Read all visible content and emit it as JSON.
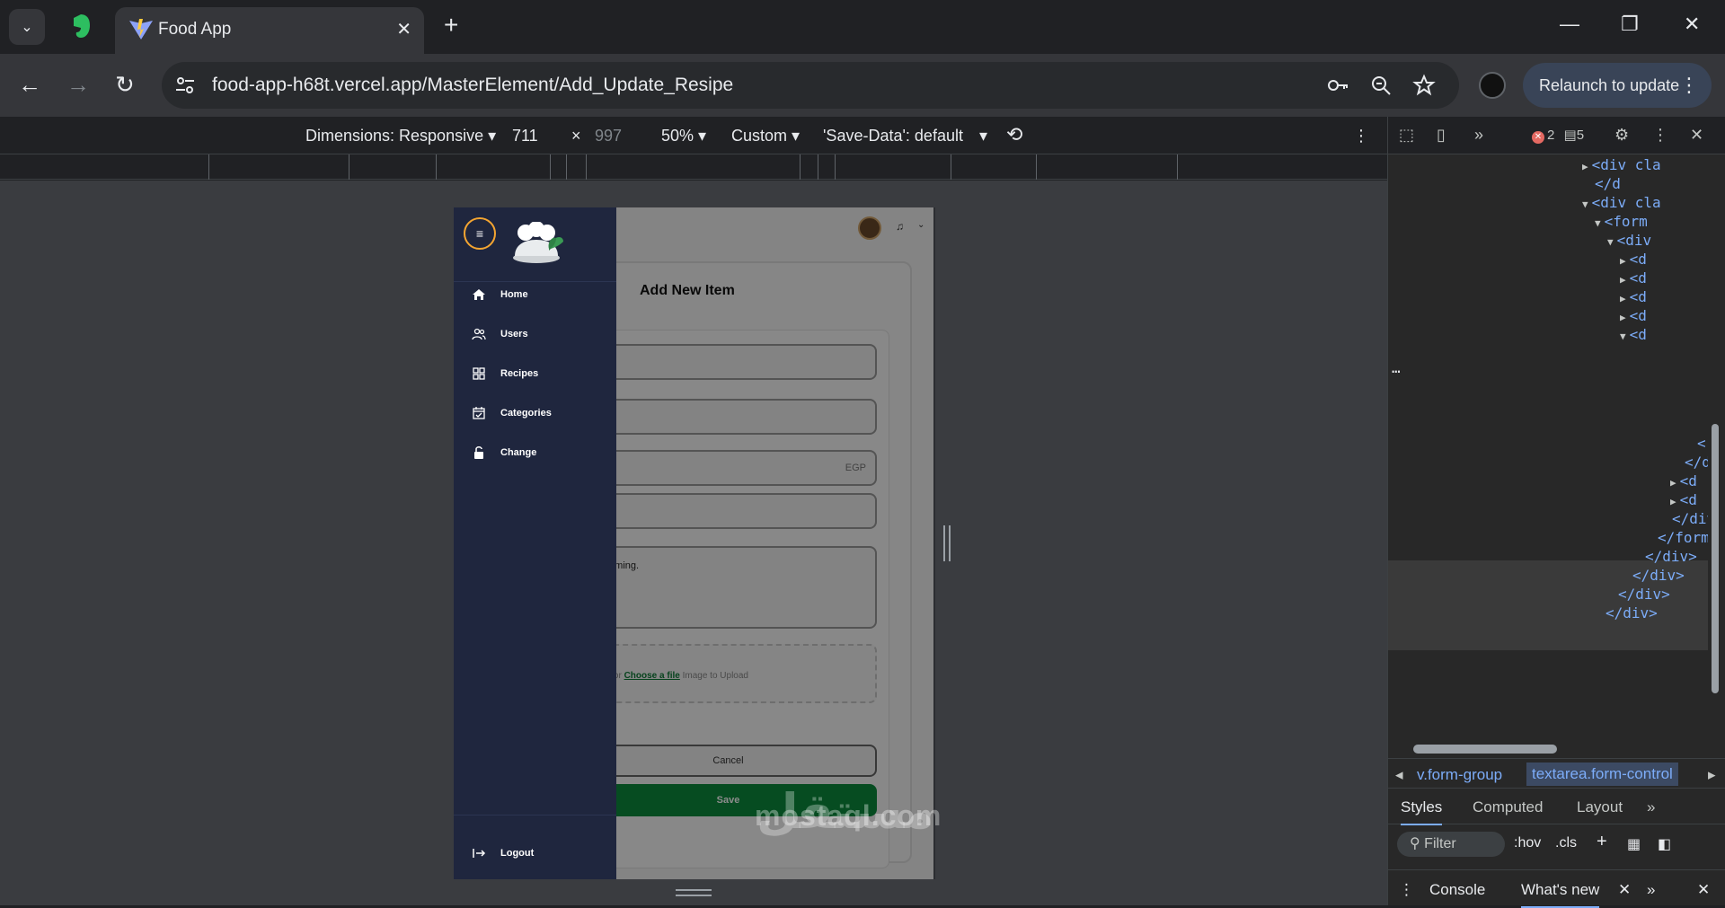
{
  "browser": {
    "tab_title": "Food App",
    "url": "food-app-h68t.vercel.app/MasterElement/Add_Update_Resipe",
    "relaunch_label": "Relaunch to update"
  },
  "device_toolbar": {
    "dimensions_label": "Dimensions: Responsive ▾",
    "width": "711",
    "times": "×",
    "height": "997",
    "zoom": "50% ▾",
    "throttle": "Custom ▾",
    "save_data": "'Save-Data': default"
  },
  "app": {
    "sidebar": {
      "items": [
        {
          "label": "Home"
        },
        {
          "label": "Users"
        },
        {
          "label": "Recipes"
        },
        {
          "label": "Categories"
        },
        {
          "label": "Change"
        }
      ],
      "logout": "Logout"
    },
    "form": {
      "title": "Add New Item",
      "price_suffix": "EGP",
      "description_value": "ogramming.",
      "upload_prefix": "& Drop or ",
      "upload_link": "Choose a file",
      "upload_suffix": " Image to Upload",
      "cancel_label": "Cancel",
      "save_label": "Save"
    }
  },
  "devtools": {
    "errors": "2",
    "messages": "5",
    "code_lines": [
      {
        "text": "<div cla",
        "tri": "▶"
      },
      {
        "text": "</d",
        "tri": ""
      },
      {
        "text": "<div cla",
        "tri": "▼"
      },
      {
        "text": "<form",
        "tri": "▼"
      },
      {
        "text": "<div",
        "tri": "▼"
      },
      {
        "text": "<d",
        "tri": "▶"
      },
      {
        "text": "<d",
        "tri": "▶"
      },
      {
        "text": "<d",
        "tri": "▶"
      },
      {
        "text": "<d",
        "tri": "▶"
      },
      {
        "text": "<d",
        "tri": "▼"
      }
    ],
    "code_lines_bottom": [
      {
        "text": "<",
        "tri": ""
      },
      {
        "text": "</d",
        "tri": ""
      },
      {
        "text": "<d",
        "tri": "▶"
      },
      {
        "text": "<d",
        "tri": "▶"
      },
      {
        "text": "</div",
        "tri": ""
      },
      {
        "text": "</form",
        "tri": ""
      },
      {
        "text": "</div>",
        "tri": ""
      },
      {
        "text": "</div>",
        "tri": ""
      },
      {
        "text": "</div>",
        "tri": ""
      },
      {
        "text": "</div>",
        "tri": ""
      }
    ],
    "ellipsis": "…",
    "breadcrumb_prev": "v.form-group",
    "breadcrumb_active": "textarea.form-control",
    "styles_tabs": [
      "Styles",
      "Computed",
      "Layout"
    ],
    "filter_placeholder": "Filter",
    "hov": ":hov",
    "cls": ".cls",
    "drawer_tabs": [
      "Console",
      "What's new"
    ]
  },
  "watermark": {
    "latin": "mostaql.com",
    "arabic": "مستقل"
  },
  "colors": {
    "sidebar_bg": "#1f263e",
    "accent_orange": "#f4a531",
    "save_green": "#0b8a3c",
    "devtools_tag": "#7cacf8"
  }
}
